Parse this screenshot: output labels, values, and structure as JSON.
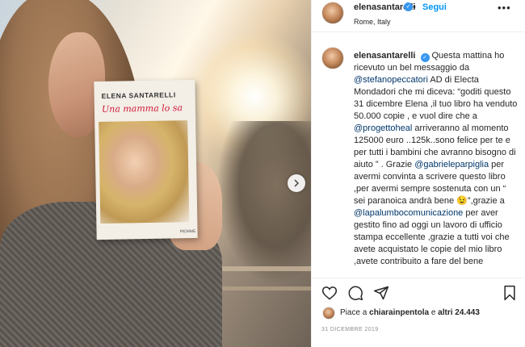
{
  "post": {
    "username": "elenasantarelli",
    "follow_label": "Segui",
    "separator": "•",
    "more_label": "•••",
    "location": "Rome, Italy",
    "book": {
      "author": "ELENA SANTARELLI",
      "title": "Una mamma lo sa",
      "publisher": "PIEMME"
    },
    "caption": {
      "username": "elenasantarelli",
      "segments": [
        {
          "t": "Questa mattina ho ricevuto un bel messaggio da ",
          "m": false
        },
        {
          "t": "@stefanopeccatori",
          "m": true
        },
        {
          "t": " AD di Electa Mondadori che mi diceva: “goditi questo 31 dicembre Elena ,il tuo libro ha venduto 50.000 copie , e vuol dire che a ",
          "m": false
        },
        {
          "t": "@progettoheal",
          "m": true
        },
        {
          "t": " arriveranno al momento 125000 euro ..125k..sono felice per te e per tutti i bambini che avranno bisogno di aiuto ” . Grazie ",
          "m": false
        },
        {
          "t": "@gabrieleparpiglia",
          "m": true
        },
        {
          "t": " per avermi convinta a scrivere questo libro ,per avermi sempre sostenuta con un “ sei paranoica andrà bene 😉”,grazie a ",
          "m": false
        },
        {
          "t": "@lapalumbocomunicazione",
          "m": true
        },
        {
          "t": " per aver gestito fino ad oggi un lavoro di ufficio stampa eccellente ,grazie a tutti voi che avete acquistato le copie del mio libro ,avete contribuito a fare del bene",
          "m": false
        }
      ]
    },
    "likes": {
      "prefix": "Piace a",
      "user": "chiarainpentola",
      "middle": "e",
      "others": "altri 24.443"
    },
    "date": "31 DICEMBRE 2019"
  },
  "icons": {
    "verified": "verified-badge-icon",
    "like": "heart-icon",
    "comment": "comment-icon",
    "share": "share-icon",
    "save": "bookmark-icon",
    "next": "chevron-right-icon"
  },
  "colors": {
    "follow": "#0095f6",
    "verified": "#3897f0",
    "mention": "#00376b",
    "book_title": "#d0183a"
  }
}
